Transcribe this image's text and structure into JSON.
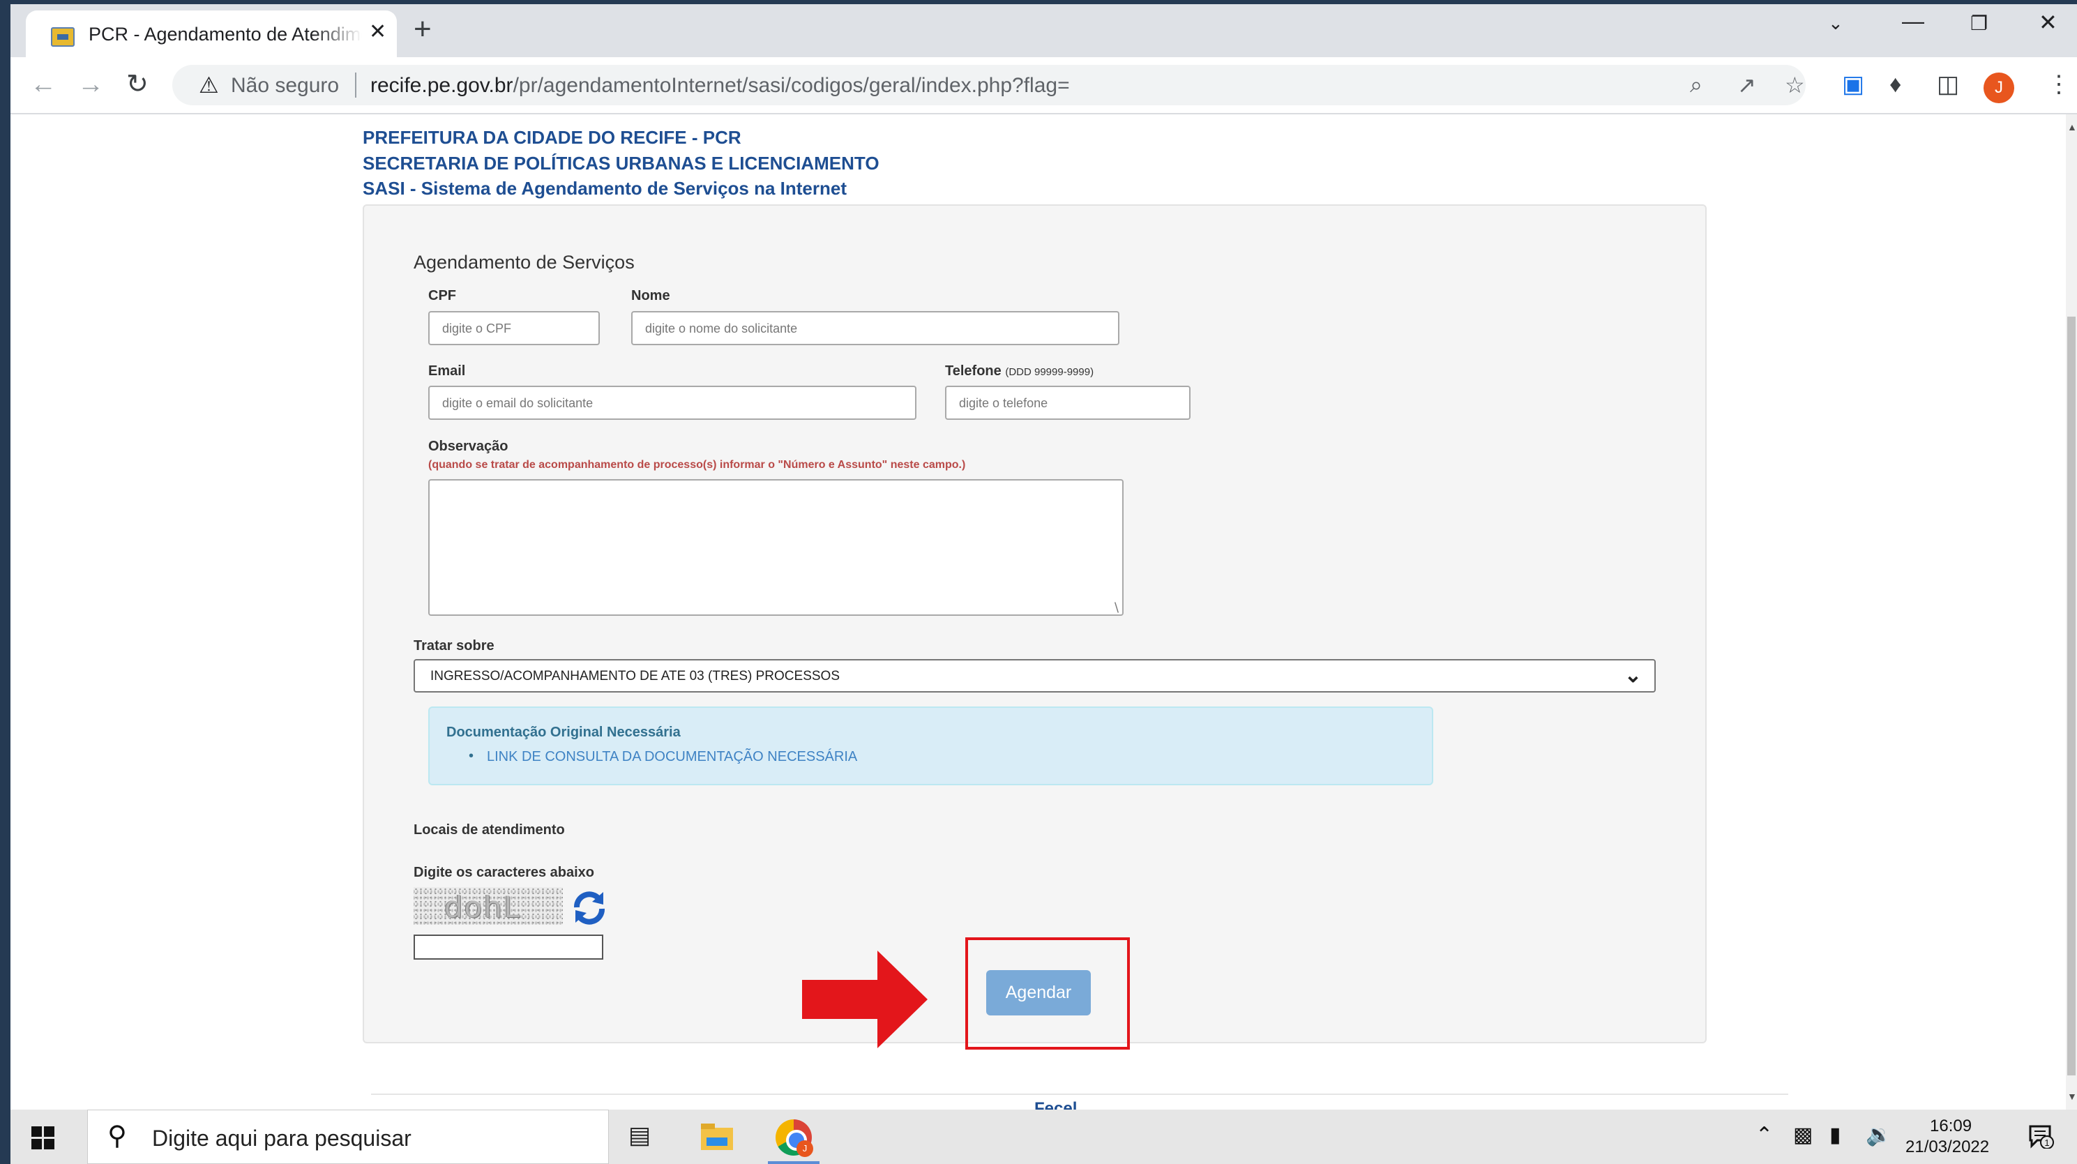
{
  "browser": {
    "tab_title": "PCR - Agendamento de Atendimento",
    "tab_close": "✕",
    "new_tab": "+",
    "security_label": "Não seguro",
    "url_domain": "recife.pe.gov.br",
    "url_path": "/pr/agendamentoInternet/sasi/codigos/geral/index.php?flag=",
    "profile_initial": "J"
  },
  "header": {
    "line1": "PREFEITURA DA CIDADE DO RECIFE - PCR",
    "line2": "SECRETARIA DE POLÍTICAS URBANAS E LICENCIAMENTO",
    "line3": "SASI - Sistema de Agendamento de Serviços na Internet"
  },
  "form": {
    "legend": "Agendamento de Serviços",
    "cpf_label": "CPF",
    "cpf_placeholder": "digite o CPF",
    "nome_label": "Nome",
    "nome_placeholder": "digite o nome do solicitante",
    "email_label": "Email",
    "email_placeholder": "digite o email do solicitante",
    "telefone_label": "Telefone",
    "telefone_hint": "(DDD 99999-9999)",
    "telefone_placeholder": "digite o telefone",
    "obs_label": "Observação",
    "obs_hint": "(quando se tratar de acompanhamento de processo(s) informar o \"Número e Assunto\" neste campo.)",
    "tratar_label": "Tratar sobre",
    "tratar_selected": "INGRESSO/ACOMPANHAMENTO DE ATE 03 (TRES) PROCESSOS",
    "doc_title": "Documentação Original Necessária",
    "doc_link": "LINK DE CONSULTA DA DOCUMENTAÇÃO NECESSÁRIA",
    "locais_label": "Locais de atendimento",
    "captcha_label": "Digite os caracteres abaixo",
    "captcha_text": "dohL",
    "submit_label": "Agendar"
  },
  "footer_peek": "Fecel",
  "taskbar": {
    "search_placeholder": "Digite aqui para pesquisar",
    "time": "16:09",
    "date": "21/03/2022",
    "chrome_badge": "J",
    "notification_count": "1"
  },
  "colors": {
    "header_blue": "#1e4e92",
    "highlight_red": "#e3161b",
    "button_blue": "#7aaad8",
    "info_bg": "#d9edf7"
  }
}
